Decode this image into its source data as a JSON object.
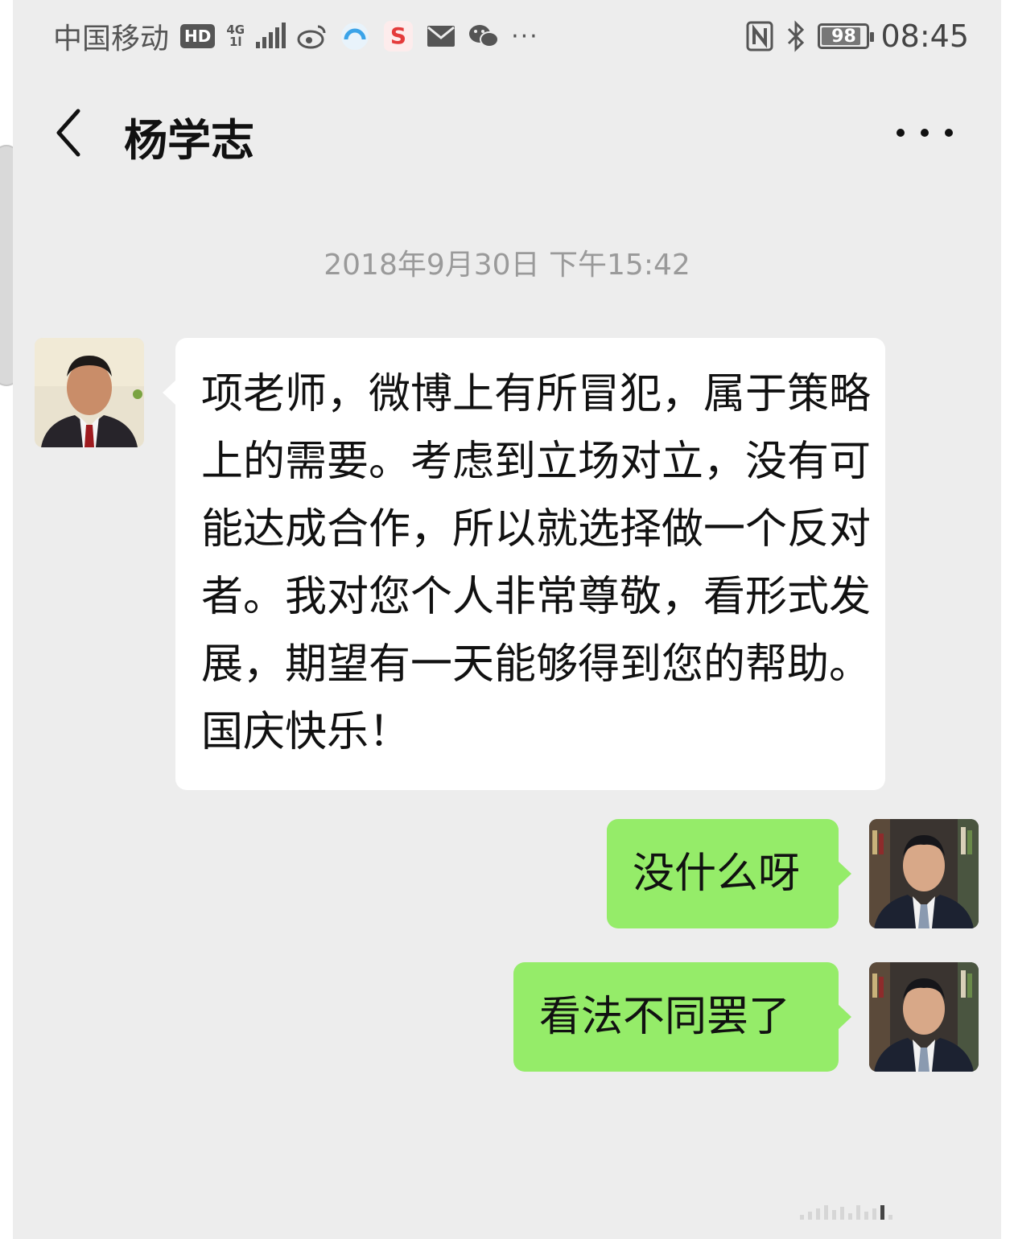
{
  "status_bar": {
    "carrier": "中国移动",
    "hd_label": "HD",
    "network_top": "4G",
    "network_bottom": "1l",
    "overflow": "···",
    "battery_level": "98",
    "time": "08:45"
  },
  "header": {
    "title": "杨学志"
  },
  "chat": {
    "timestamp": "2018年9月30日 下午15:42",
    "messages": [
      {
        "side": "in",
        "text": "项老师，微博上有所冒犯，属于策略上的需要。考虑到立场对立，没有可能达成合作，所以就选择做一个反对者。我对您个人非常尊敬，看形式发展，期望有一天能够得到您的帮助。国庆快乐！"
      },
      {
        "side": "out",
        "text": "没什么呀"
      },
      {
        "side": "out",
        "text": "看法不同罢了"
      }
    ]
  },
  "colors": {
    "background": "#ededed",
    "incoming_bubble": "#ffffff",
    "outgoing_bubble": "#95ec69"
  }
}
